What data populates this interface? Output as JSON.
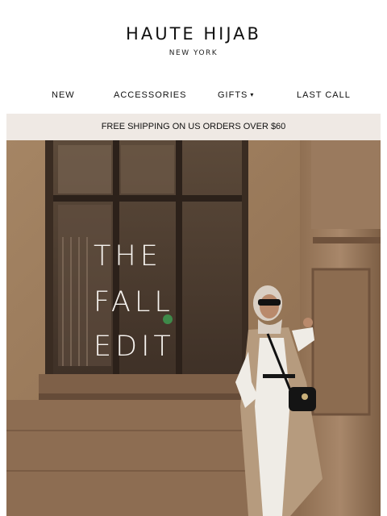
{
  "brand": {
    "name": "HAUTE HIJAB",
    "location": "NEW YORK"
  },
  "nav": {
    "items": [
      {
        "label": "NEW"
      },
      {
        "label": "ACCESSORIES"
      },
      {
        "label": "GIFTS",
        "icon": "chevron-down-icon"
      },
      {
        "label": "LAST CALL"
      }
    ]
  },
  "promo_banner": {
    "text": "FREE SHIPPING ON US ORDERS OVER $60"
  },
  "hero": {
    "title_lines": [
      "THE",
      "FALL",
      "EDIT"
    ]
  },
  "colors": {
    "banner_bg": "#efe9e4",
    "hero_wall": "#9c7a5a",
    "text": "#111111"
  }
}
